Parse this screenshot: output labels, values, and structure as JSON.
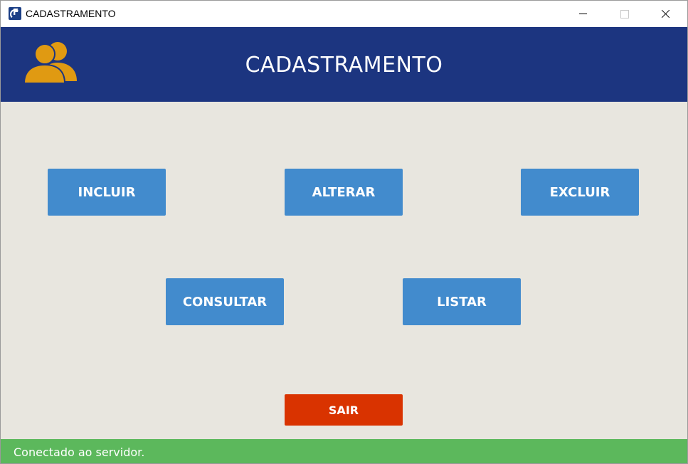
{
  "window": {
    "title": "CADASTRAMENTO",
    "app_icon_letter": "F",
    "controls": {
      "minimize_icon": "minimize-icon",
      "maximize_icon": "maximize-icon",
      "close_icon": "close-icon"
    }
  },
  "header": {
    "title": "CADASTRAMENTO",
    "icon": "users-icon",
    "background_color": "#1c3580",
    "icon_color": "#e09a12"
  },
  "actions": {
    "incluir_label": "INCLUIR",
    "alterar_label": "ALTERAR",
    "excluir_label": "EXCLUIR",
    "consultar_label": "CONSULTAR",
    "listar_label": "LISTAR",
    "sair_label": "SAIR",
    "primary_color": "#428bcd",
    "exit_color": "#d93300"
  },
  "status": {
    "text": "Conectado ao servidor.",
    "color": "#5cb85c"
  }
}
